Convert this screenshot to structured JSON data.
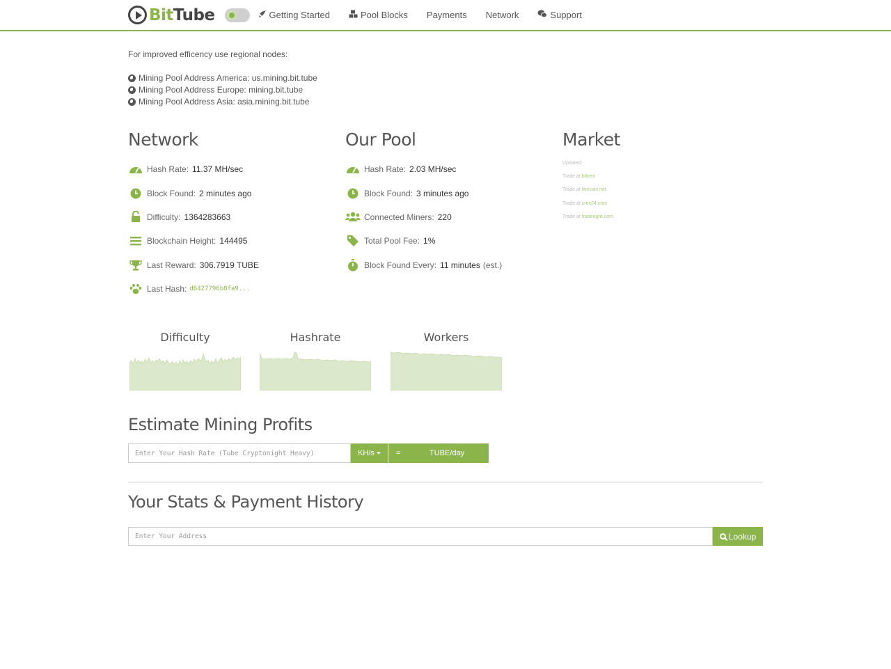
{
  "nav": {
    "logo_bit": "Bit",
    "logo_tube": "Tube",
    "links": [
      "Getting Started",
      "Pool Blocks",
      "Payments",
      "Network",
      "Support"
    ]
  },
  "intro": {
    "text": "For improved efficency use regional nodes:",
    "nodes": [
      "Mining Pool Address America: us.mining.bit.tube",
      "Mining Pool Address Europe: mining.bit.tube",
      "Mining Pool Address Asia: asia.mining.bit.tube"
    ]
  },
  "network": {
    "title": "Network",
    "stats": [
      {
        "icon": "gauge-icon",
        "label": "Hash Rate:",
        "value": "11.37 MH/sec"
      },
      {
        "icon": "clock-icon",
        "label": "Block Found:",
        "value": "2 minutes ago"
      },
      {
        "icon": "unlock-icon",
        "label": "Difficulty:",
        "value": "1364283663"
      },
      {
        "icon": "bars-icon",
        "label": "Blockchain Height:",
        "value": "144495"
      },
      {
        "icon": "trophy-icon",
        "label": "Last Reward:",
        "value": "306.7919 TUBE"
      },
      {
        "icon": "paw-icon",
        "label": "Last Hash:",
        "value": "d6427796b8fa9..."
      }
    ]
  },
  "pool": {
    "title": "Our Pool",
    "stats": [
      {
        "icon": "gauge-icon",
        "label": "Hash Rate:",
        "value": "2.03 MH/sec"
      },
      {
        "icon": "clock-icon",
        "label": "Block Found:",
        "value": "3 minutes ago"
      },
      {
        "icon": "users-icon",
        "label": "Connected Miners:",
        "value": "220"
      },
      {
        "icon": "tag-icon",
        "label": "Total Pool Fee:",
        "value": "1%"
      },
      {
        "icon": "stopwatch-icon",
        "label": "Block Found Every:",
        "value": "11 minutes",
        "suffix": "(est.)"
      }
    ]
  },
  "market": {
    "title": "Market",
    "updated": "Updated:",
    "trade_prefix": "Trade at",
    "exchanges": [
      "bittrex",
      "livecoin.net",
      "crex24.com",
      "tradeogre.com"
    ]
  },
  "charts": [
    {
      "title": "Difficulty"
    },
    {
      "title": "Hashrate"
    },
    {
      "title": "Workers"
    }
  ],
  "chart_colors": {
    "fill": "#dce8cc",
    "stroke": "#c5d9a8"
  },
  "estimate": {
    "title": "Estimate Mining Profits",
    "placeholder": "Enter Your Hash Rate (Tube Cryptonight Heavy)",
    "unit": "KH/s",
    "equals": "=",
    "result_unit": "TUBE/day"
  },
  "stats_section": {
    "title": "Your Stats & Payment History",
    "placeholder": "Enter Your Address",
    "lookup": "Lookup"
  },
  "accent": "#8bb54a"
}
